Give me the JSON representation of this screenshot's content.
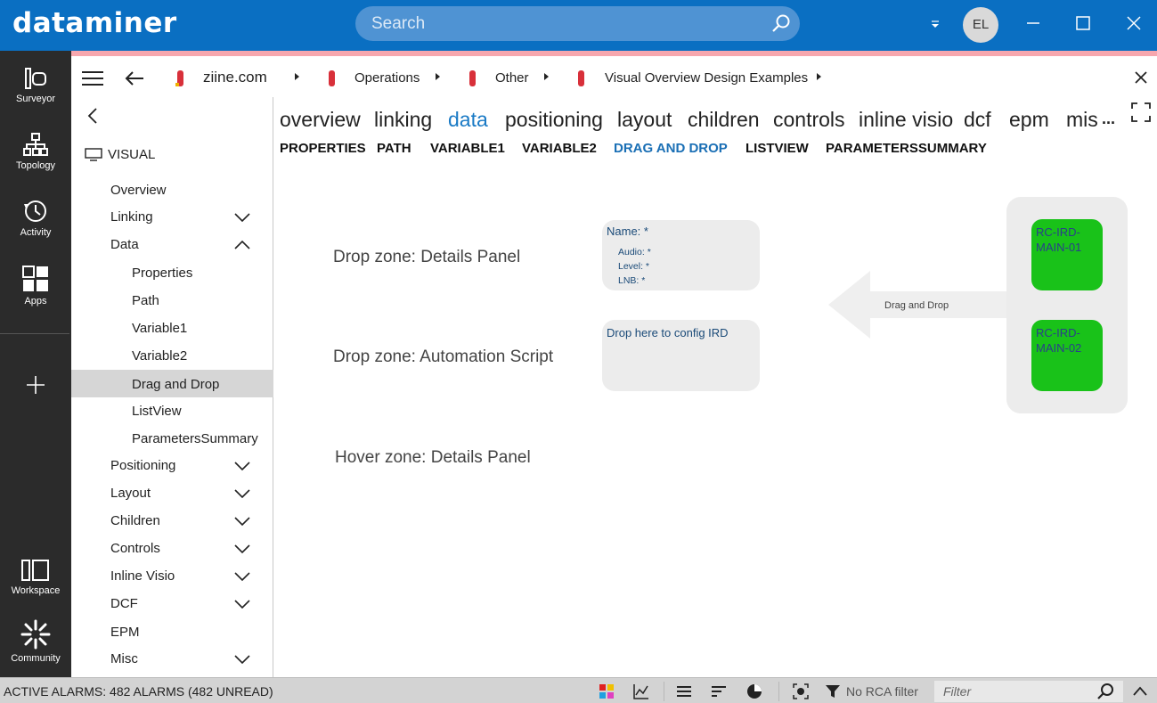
{
  "app": {
    "logo": "dataminer"
  },
  "search": {
    "placeholder": "Search"
  },
  "user": {
    "initials": "EL"
  },
  "rail": {
    "items": [
      {
        "label": "Surveyor",
        "icon": "surveyor-icon"
      },
      {
        "label": "Topology",
        "icon": "topology-icon"
      },
      {
        "label": "Activity",
        "icon": "activity-icon"
      },
      {
        "label": "Apps",
        "icon": "apps-icon"
      },
      {
        "label": "Workspace",
        "icon": "workspace-icon"
      },
      {
        "label": "Community",
        "icon": "community-icon"
      }
    ],
    "add_icon": "plus-icon"
  },
  "breadcrumb": {
    "items": [
      "ziine.com",
      "Operations",
      "Other",
      "Visual Overview Design Examples"
    ]
  },
  "leftnav": {
    "root": "VISUAL",
    "items": [
      {
        "label": "Overview"
      },
      {
        "label": "Linking"
      },
      {
        "label": "Data"
      },
      {
        "label": "Properties"
      },
      {
        "label": "Path"
      },
      {
        "label": "Variable1"
      },
      {
        "label": "Variable2"
      },
      {
        "label": "Drag and Drop"
      },
      {
        "label": "ListView"
      },
      {
        "label": "ParametersSummary"
      },
      {
        "label": "Positioning"
      },
      {
        "label": "Layout"
      },
      {
        "label": "Children"
      },
      {
        "label": "Controls"
      },
      {
        "label": "Inline Visio"
      },
      {
        "label": "DCF"
      },
      {
        "label": "EPM"
      },
      {
        "label": "Misc"
      }
    ]
  },
  "tabs_primary": [
    "overview",
    "linking",
    "data",
    "positioning",
    "layout",
    "children",
    "controls",
    "inline visio",
    "dcf",
    "epm",
    "mis",
    "..."
  ],
  "tabs_secondary": [
    "PROPERTIES",
    "PATH",
    "VARIABLE1",
    "VARIABLE2",
    "DRAG AND DROP",
    "LISTVIEW",
    "PARAMETERSSUMMARY"
  ],
  "canvas": {
    "zone1": "Drop zone: Details Panel",
    "zone2": "Drop zone: Automation Script",
    "zone3": "Hover zone: Details Panel",
    "details_panel": {
      "title": "Name: *",
      "lines": [
        "Audio: *",
        "Level: *",
        "LNB: *"
      ]
    },
    "script_panel": {
      "title": "Drop here to config IRD"
    },
    "drag_label": "Drag and Drop",
    "ird1": "RC-IRD-MAIN-01",
    "ird2": "RC-IRD-MAIN-02",
    "ird_color": "#19c219"
  },
  "statusbar": {
    "alarms": "ACTIVE ALARMS: 482 ALARMS (482 UNREAD)",
    "rca": "No RCA filter",
    "filter_placeholder": "Filter"
  },
  "colors": {
    "brand": "#0a6fc2",
    "accent": "#1a7ac5",
    "marker": "#d8303a"
  }
}
